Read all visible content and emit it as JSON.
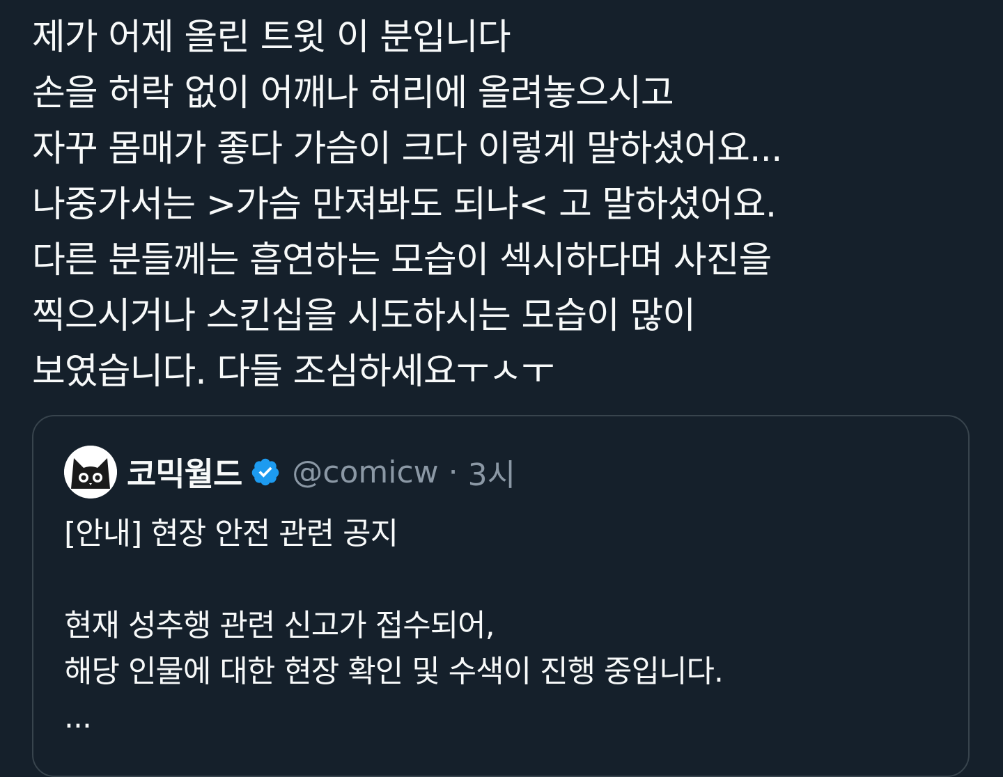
{
  "tweet": {
    "lines": [
      "제가 어제 올린 트윗 이 분입니다",
      "손을 허락 없이 어깨나 허리에 올려놓으시고",
      "자꾸 몸매가 좋다 가슴이 크다 이렇게 말하셨어요...",
      "나중가서는 >가슴 만져봐도 되냐< 고 말하셨어요.",
      "다른 분들께는 흡연하는 모습이 섹시하다며 사진을",
      "찍으시거나 스킨십을 시도하시는 모습이 많이",
      "보였습니다. 다들 조심하세요ㅜㅅㅜ"
    ]
  },
  "quote": {
    "avatar_icon": "cat-avatar-icon",
    "display_name": "코믹월드",
    "verified_icon": "verified-badge-icon",
    "handle": "@comicw",
    "separator": "·",
    "timestamp": "3시",
    "lines": [
      "[안내] 현장 안전 관련 공지",
      "",
      "현재 성추행 관련 신고가 접수되어,",
      "해당 인물에 대한 현장 확인 및 수색이 진행 중입니다.",
      "..."
    ]
  },
  "colors": {
    "background": "#15202b",
    "border": "#38444d",
    "text": "#f7f9f9",
    "secondary_text": "#8b98a5",
    "verified": "#1d9bf0"
  }
}
